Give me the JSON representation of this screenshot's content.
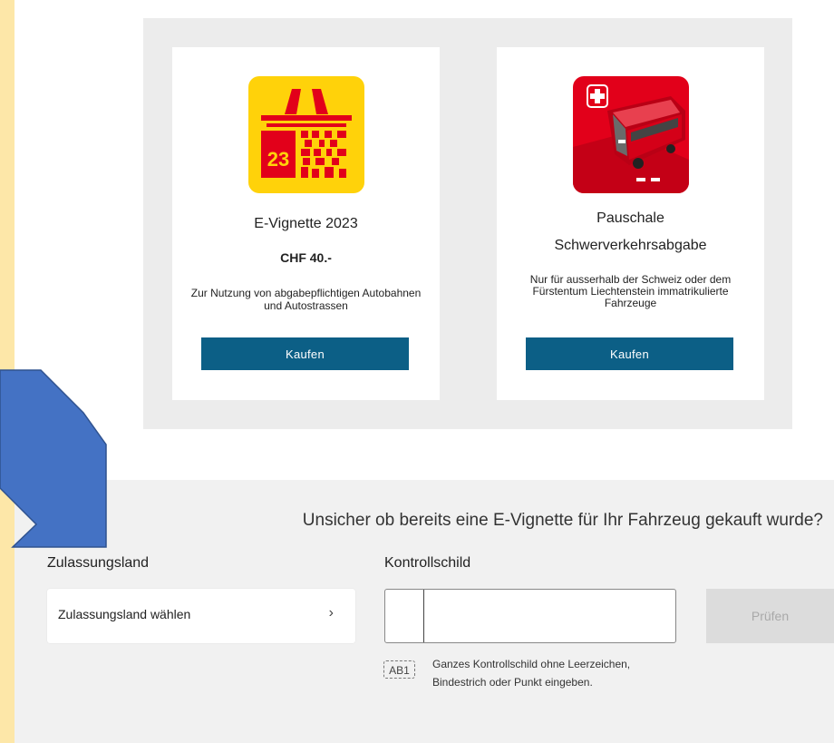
{
  "products": [
    {
      "title": "E-Vignette 2023",
      "price": "CHF 40.-",
      "description": "Zur Nutzung von abgabepflichtigen Autobahnen und Autostrassen",
      "button": "Kaufen",
      "icon": "e-vignette-logo-icon",
      "logo_text": "23"
    },
    {
      "title_line1": "Pauschale",
      "title_line2": "Schwerverkehrsabgabe",
      "description": "Nur für ausserhalb der Schweiz oder dem Fürstentum Liechtenstein immatrikulierte Fahrzeuge",
      "button": "Kaufen",
      "icon": "swiss-bus-icon"
    }
  ],
  "check": {
    "question": "Unsicher ob bereits eine E-Vignette für Ihr Fahrzeug gekauft wurde?",
    "country_label": "Zulassungsland",
    "country_placeholder": "Zulassungsland wählen",
    "plate_label": "Kontrollschild",
    "plate_value": "",
    "plate_icon_text": "AB1",
    "hint": "Ganzes Kontrollschild ohne Leerzeichen, Bindestrich oder Punkt eingeben.",
    "button": "Prüfen"
  },
  "colors": {
    "primary": "#0c5f86",
    "vignette_yellow": "#ffd20a",
    "vignette_red": "#e2001a",
    "arrow_blue": "#4472c4"
  }
}
